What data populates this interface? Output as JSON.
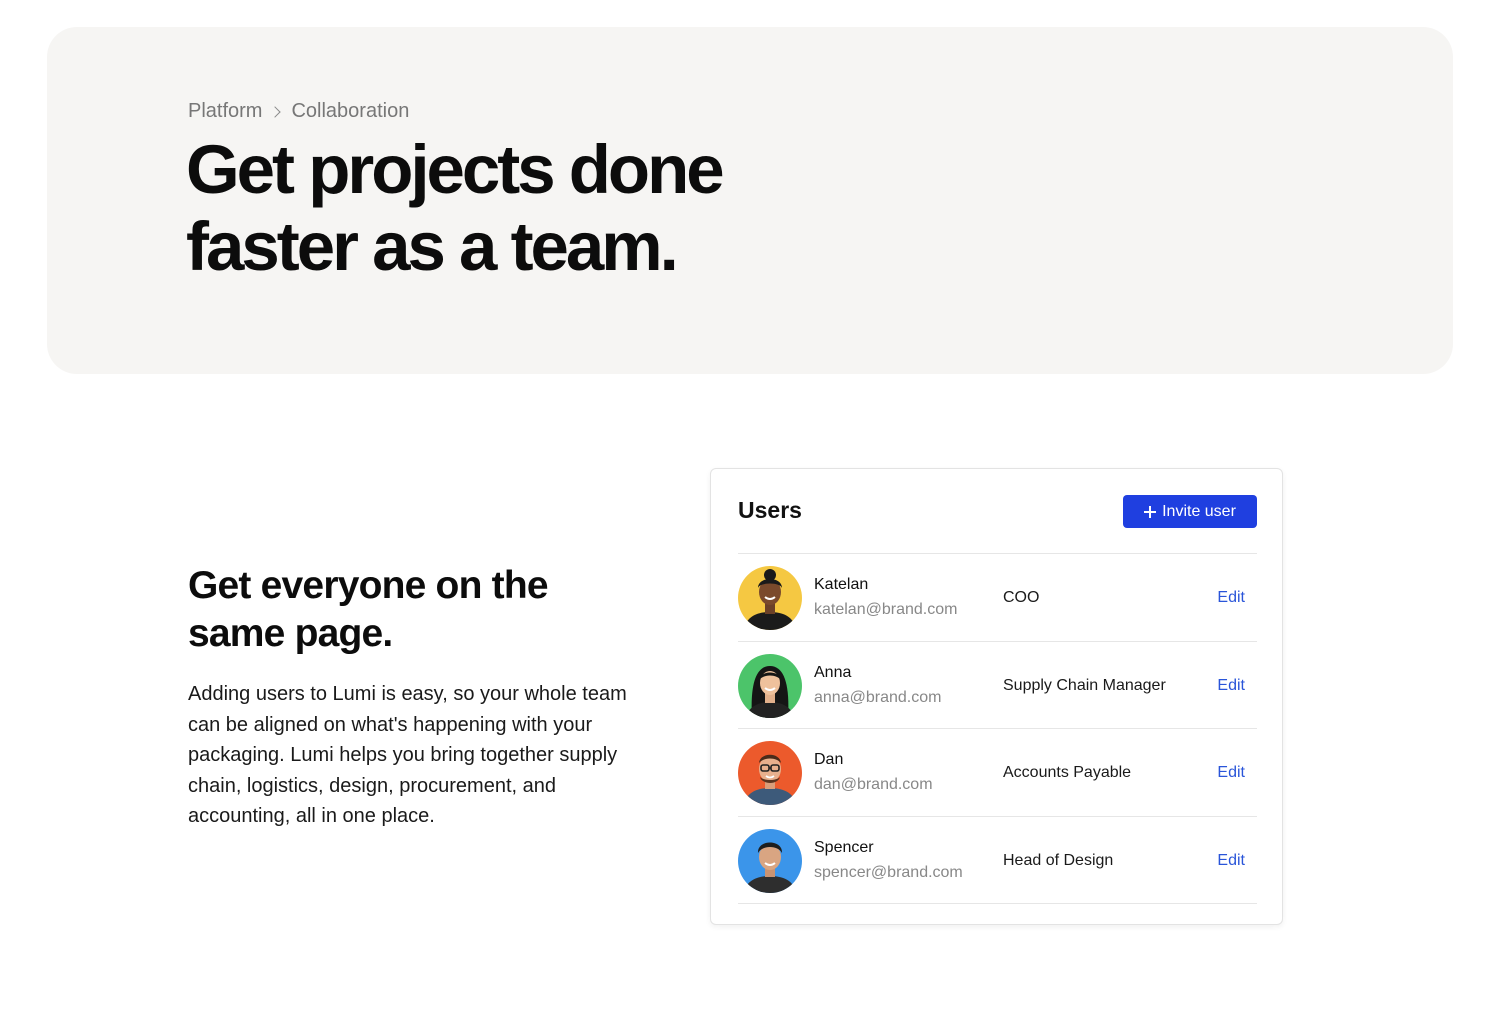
{
  "hero": {
    "breadcrumb": [
      "Platform",
      "Collaboration"
    ],
    "title": "Get projects done faster as a team."
  },
  "feature": {
    "title": "Get everyone on the same page.",
    "body": "Adding users to Lumi is easy, so your whole team can be aligned on what's happening with your packaging. Lumi helps you bring together supply chain, logistics, design, procurement, and accounting, all in one place."
  },
  "users_card": {
    "title": "Users",
    "invite_label": "Invite user",
    "edit_label": "Edit",
    "users": [
      {
        "name": "Katelan",
        "email": "katelan@brand.com",
        "role": "COO",
        "avatar_bg": "#f5c842"
      },
      {
        "name": "Anna",
        "email": "anna@brand.com",
        "role": "Supply Chain Manager",
        "avatar_bg": "#4cc46a"
      },
      {
        "name": "Dan",
        "email": "dan@brand.com",
        "role": "Accounts Payable",
        "avatar_bg": "#ec5a2c"
      },
      {
        "name": "Spencer",
        "email": "spencer@brand.com",
        "role": "Head of Design",
        "avatar_bg": "#3b95ea"
      }
    ]
  },
  "colors": {
    "hero_bg": "#f6f5f3",
    "accent": "#1f3fe0",
    "link": "#2a55d9"
  }
}
